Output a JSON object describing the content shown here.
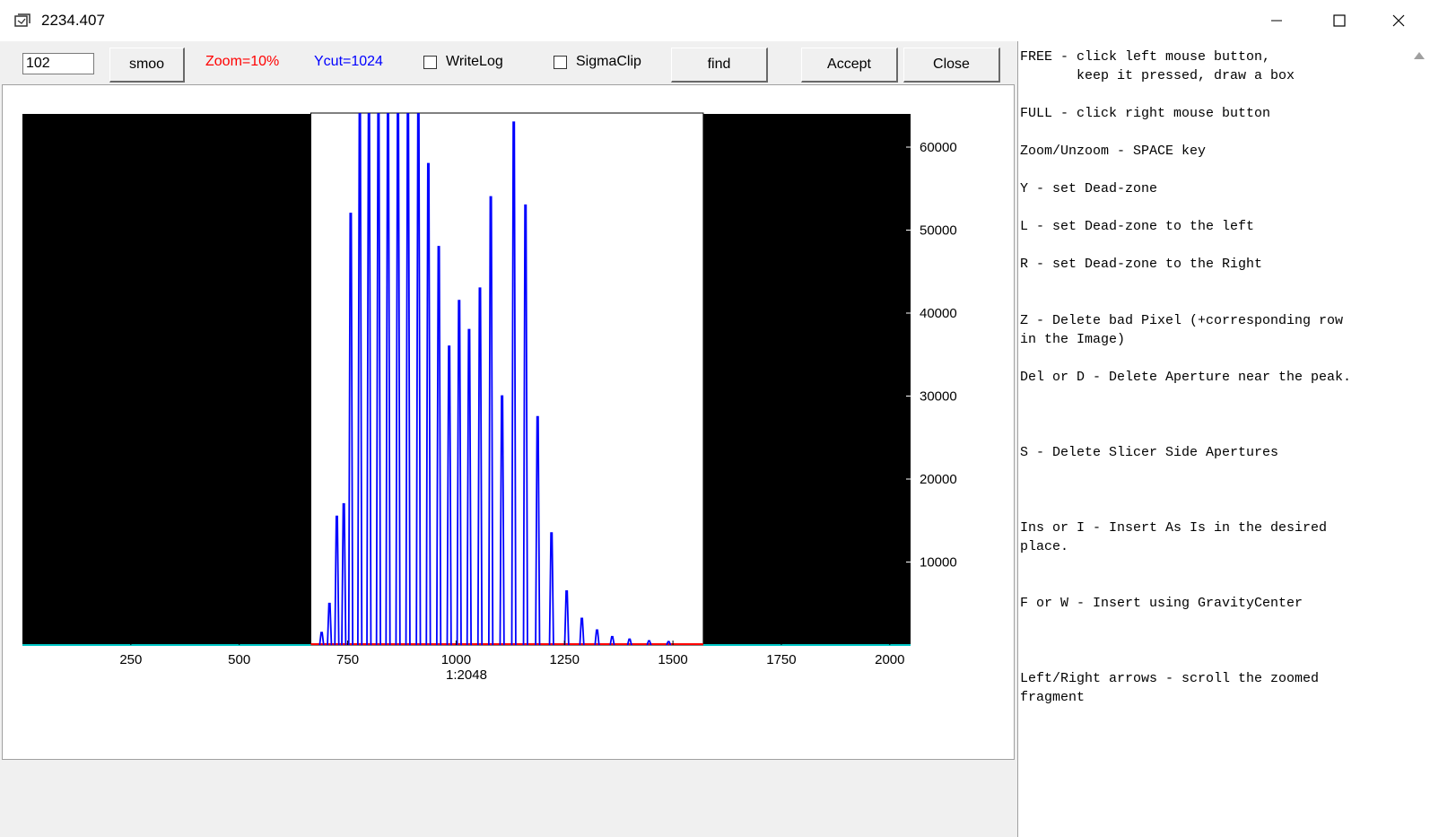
{
  "window": {
    "title": "2234.407"
  },
  "toolbar": {
    "input_value": "102",
    "smoo_label": "smoo",
    "zoom_label": "Zoom=10%",
    "ycut_label": "Ycut=1024",
    "writelog_label": "WriteLog",
    "writelog_checked": false,
    "sigmaclip_label": "SigmaClip",
    "sigmaclip_checked": false,
    "find_label": "find",
    "accept_label": "Accept",
    "close_label": "Close",
    "colors": {
      "zoom": "#ff0000",
      "ycut": "#0000ff"
    }
  },
  "help": {
    "lines": [
      "FREE - click left mouse button,",
      "       keep it pressed, draw a box",
      "",
      "FULL - click right mouse button",
      "",
      "Zoom/Unzoom - SPACE key",
      "",
      "Y - set Dead-zone",
      "",
      "L - set Dead-zone to the left",
      "",
      "R - set Dead-zone to the Right",
      "",
      "",
      "Z - Delete bad Pixel (+corresponding row",
      "in the Image)",
      "",
      "Del or D - Delete Aperture near the peak.",
      "",
      "",
      "",
      "S - Delete Slicer Side Apertures",
      "",
      "",
      "",
      "Ins or I - Insert As Is in the desired",
      "place.",
      "",
      "",
      "F or W - Insert using GravityCenter",
      "",
      "",
      "",
      "Left/Right arrows - scroll the zoomed",
      "fragment"
    ]
  },
  "chart_data": {
    "type": "line",
    "title": "",
    "xlabel": "1:2048",
    "ylabel": "",
    "xlim": [
      0,
      2048
    ],
    "ylim": [
      0,
      64000
    ],
    "x_ticks": [
      250,
      500,
      750,
      1000,
      1250,
      1500,
      1750,
      2000
    ],
    "y_ticks": [
      10000,
      20000,
      30000,
      40000,
      50000,
      60000
    ],
    "zoom_window": [
      665,
      1570
    ],
    "grid": false,
    "colors": {
      "background": "#000000",
      "window": "#ffffff",
      "signal": "#0000ff",
      "baseline_window": "#ff0000",
      "baseline_outside": "#00c8c8"
    },
    "peaks": [
      {
        "x": 690,
        "y": 1500
      },
      {
        "x": 708,
        "y": 5000
      },
      {
        "x": 725,
        "y": 15500
      },
      {
        "x": 741,
        "y": 17000
      },
      {
        "x": 757,
        "y": 52000
      },
      {
        "x": 778,
        "y": 64000
      },
      {
        "x": 799,
        "y": 64000
      },
      {
        "x": 821,
        "y": 64000
      },
      {
        "x": 843,
        "y": 64000
      },
      {
        "x": 866,
        "y": 64000
      },
      {
        "x": 889,
        "y": 64000
      },
      {
        "x": 913,
        "y": 64000
      },
      {
        "x": 936,
        "y": 58000
      },
      {
        "x": 960,
        "y": 48000
      },
      {
        "x": 984,
        "y": 36000
      },
      {
        "x": 1007,
        "y": 41500
      },
      {
        "x": 1030,
        "y": 38000
      },
      {
        "x": 1055,
        "y": 43000
      },
      {
        "x": 1080,
        "y": 54000
      },
      {
        "x": 1106,
        "y": 30000
      },
      {
        "x": 1133,
        "y": 63000
      },
      {
        "x": 1160,
        "y": 53000
      },
      {
        "x": 1188,
        "y": 27500
      },
      {
        "x": 1220,
        "y": 13500
      },
      {
        "x": 1255,
        "y": 6500
      },
      {
        "x": 1290,
        "y": 3200
      },
      {
        "x": 1325,
        "y": 1800
      },
      {
        "x": 1360,
        "y": 1000
      },
      {
        "x": 1400,
        "y": 700
      },
      {
        "x": 1445,
        "y": 500
      },
      {
        "x": 1490,
        "y": 400
      }
    ]
  }
}
